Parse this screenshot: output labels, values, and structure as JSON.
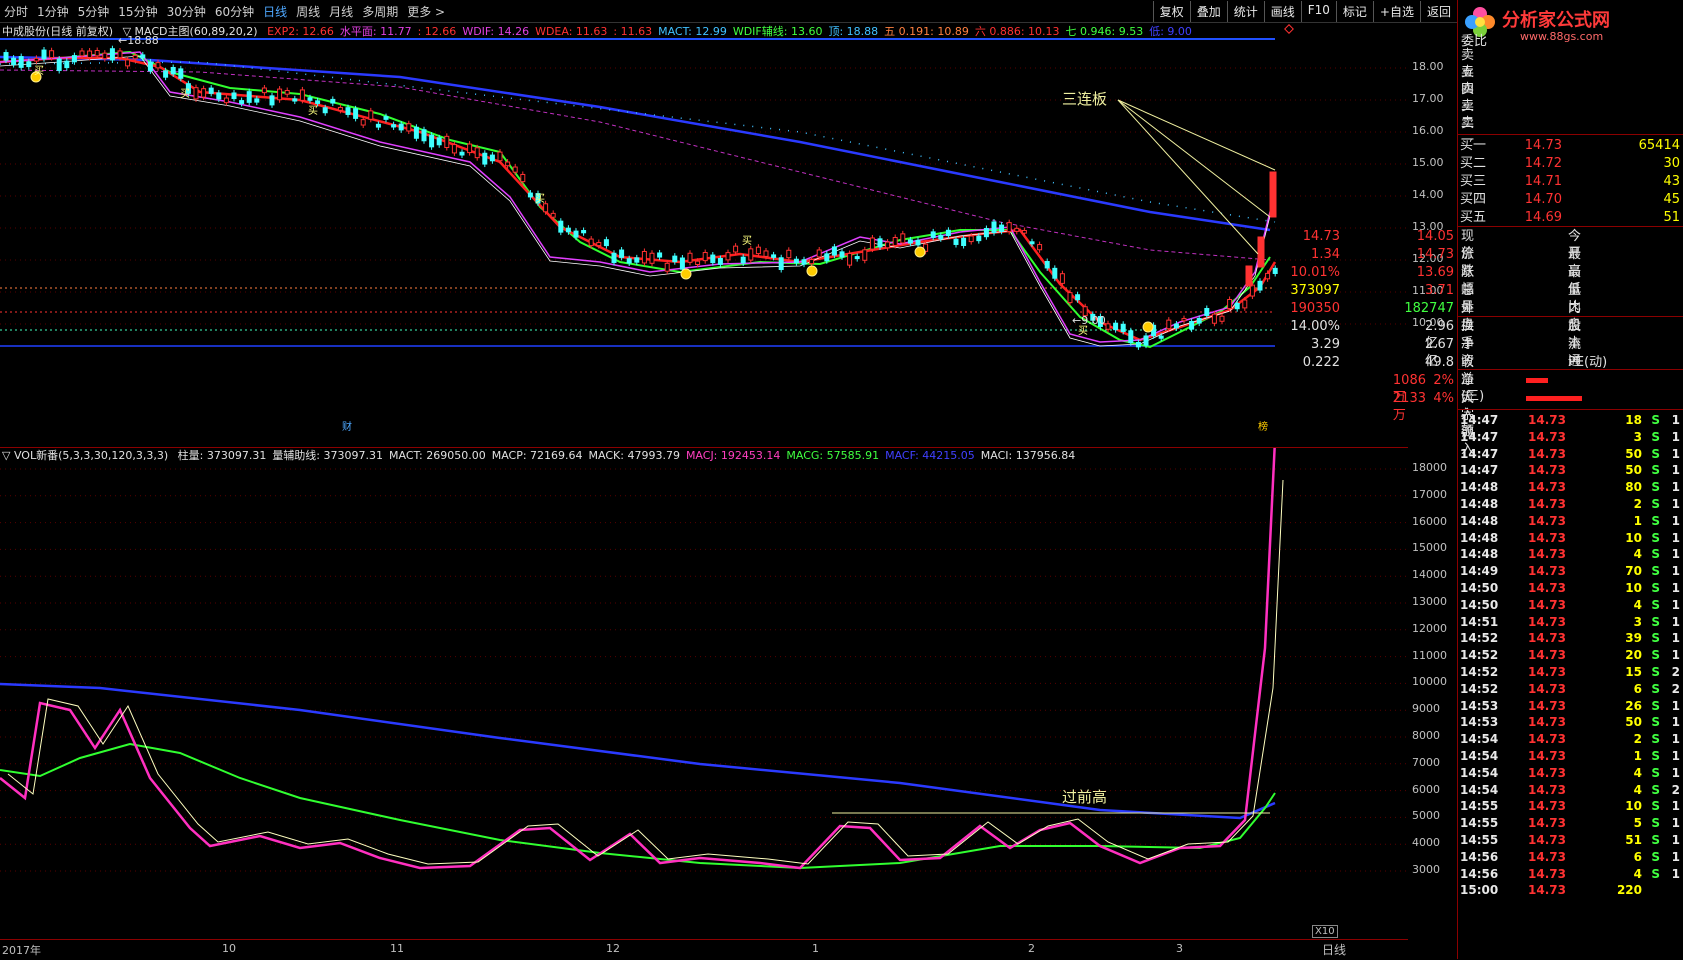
{
  "toolbar": {
    "periods": [
      "分时",
      "1分钟",
      "5分钟",
      "15分钟",
      "30分钟",
      "60分钟",
      "日线",
      "周线",
      "月线",
      "多周期",
      "更多 >"
    ],
    "active_period": "日线",
    "buttons": [
      "复权",
      "叠加",
      "统计",
      "画线",
      "F10",
      "标记",
      "+自选",
      "返回"
    ]
  },
  "main_info": {
    "stock": "中成股份(日线 前复权)",
    "indicator": "▽ MACD主图(60,89,20,2)",
    "items": [
      {
        "text": "EXP2: 12.66",
        "color": "#ff3232"
      },
      {
        "text": "水平面: 11.77",
        "color": "#e040e0"
      },
      {
        "text": ": 12.66",
        "color": "#ff3232"
      },
      {
        "text": "WDIF: 14.26",
        "color": "#e040e0"
      },
      {
        "text": "WDEA: 11.63",
        "color": "#ff3232"
      },
      {
        "text": ": 11.63",
        "color": "#ff3232"
      },
      {
        "text": "MACT: 12.99",
        "color": "#40c0ff"
      },
      {
        "text": "WDIF辅线: 13.60",
        "color": "#40ff40"
      },
      {
        "text": "顶: 18.88",
        "color": "#40c0ff"
      },
      {
        "text": "五 0.191: 10.89",
        "color": "#ff8040"
      },
      {
        "text": "六 0.886: 10.13",
        "color": "#ff3232"
      },
      {
        "text": "七 0.946: 9.53",
        "color": "#40ff40"
      },
      {
        "text": "低: 9.00",
        "color": "#4040ff"
      }
    ]
  },
  "main_marks": {
    "high_label": "18.88",
    "low_label": "9.00",
    "buy": "买",
    "cai": "财",
    "bang": "榜"
  },
  "annotations": {
    "three_limit": "三连板",
    "past_high": "过前高"
  },
  "price_axis": [
    "18.00",
    "17.00",
    "16.00",
    "15.00",
    "14.00",
    "13.00",
    "12.00",
    "11.00",
    "10.00"
  ],
  "vol_info": {
    "indicator": "▽ VOL新番(5,3,3,30,120,3,3,3)",
    "items": [
      {
        "text": "柱量: 373097.31",
        "color": "#e0e0e0"
      },
      {
        "text": "量辅助线: 373097.31",
        "color": "#e0e0e0"
      },
      {
        "text": "MACT: 269050.00",
        "color": "#e0e0e0"
      },
      {
        "text": "MACP: 72169.64",
        "color": "#e0e0e0"
      },
      {
        "text": "MACK: 47993.79",
        "color": "#e0e0e0"
      },
      {
        "text": "MACJ: 192453.14",
        "color": "#ff40c0"
      },
      {
        "text": "MACG: 57585.91",
        "color": "#40ff40"
      },
      {
        "text": "MACF: 44215.05",
        "color": "#4040ff"
      },
      {
        "text": "MACI: 137956.84",
        "color": "#e0e0e0"
      }
    ]
  },
  "vol_axis": [
    "18000",
    "17000",
    "16000",
    "15000",
    "14000",
    "13000",
    "12000",
    "11000",
    "10000",
    "9000",
    "8000",
    "7000",
    "6000",
    "5000",
    "4000",
    "3000"
  ],
  "vol_scale": "X10",
  "date_axis": [
    "2017年",
    "10",
    "11",
    "12",
    "1",
    "2",
    "3"
  ],
  "axis_mode": "日线",
  "side": {
    "logo_text": "分析家公式网",
    "logo_url": "www.88gs.com",
    "order_label": "委比",
    "sells": [
      "卖五",
      "卖四",
      "卖三",
      "卖二",
      "卖一"
    ],
    "buys": [
      {
        "label": "买一",
        "price": "14.73",
        "vol": "65414"
      },
      {
        "label": "买二",
        "price": "14.72",
        "vol": "30"
      },
      {
        "label": "买三",
        "price": "14.71",
        "vol": "43"
      },
      {
        "label": "买四",
        "price": "14.70",
        "vol": "45"
      },
      {
        "label": "买五",
        "price": "14.69",
        "vol": "51"
      }
    ],
    "quote": [
      {
        "l1": "现价",
        "v1": "14.73",
        "l2": "今开",
        "v2": "14.05"
      },
      {
        "l1": "涨跌",
        "v1": "1.34",
        "l2": "最高",
        "v2": "14.73"
      },
      {
        "l1": "涨幅",
        "v1": "10.01%",
        "l2": "最低",
        "v2": "13.69"
      },
      {
        "l1": "总量",
        "v1": "373097",
        "l2": "量比",
        "v2": "3.71"
      },
      {
        "l1": "外盘",
        "v1": "190350",
        "l2": "内盘",
        "v2": "182747"
      }
    ],
    "fund": [
      {
        "l1": "换手",
        "v1": "14.00%",
        "l2": "股本",
        "v2": "2.96亿"
      },
      {
        "l1": "净资",
        "v1": "3.29",
        "l2": "流通",
        "v2": "2.67亿"
      },
      {
        "l1": "收益(三)",
        "v1": "0.222",
        "l2": "PE(动)",
        "v2": "49.8"
      }
    ],
    "flow": [
      {
        "label": "净流入额",
        "value": "1086万",
        "pct": "2%"
      },
      {
        "label": "大宗流入",
        "value": "2133万",
        "pct": "4%"
      }
    ],
    "ticks": [
      {
        "t": "14:47",
        "p": "14.73",
        "v": "18",
        "d": "S",
        "n": "1"
      },
      {
        "t": "14:47",
        "p": "14.73",
        "v": "3",
        "d": "S",
        "n": "1"
      },
      {
        "t": "14:47",
        "p": "14.73",
        "v": "50",
        "d": "S",
        "n": "1"
      },
      {
        "t": "14:47",
        "p": "14.73",
        "v": "50",
        "d": "S",
        "n": "1"
      },
      {
        "t": "14:48",
        "p": "14.73",
        "v": "80",
        "d": "S",
        "n": "1"
      },
      {
        "t": "14:48",
        "p": "14.73",
        "v": "2",
        "d": "S",
        "n": "1"
      },
      {
        "t": "14:48",
        "p": "14.73",
        "v": "1",
        "d": "S",
        "n": "1"
      },
      {
        "t": "14:48",
        "p": "14.73",
        "v": "10",
        "d": "S",
        "n": "1"
      },
      {
        "t": "14:48",
        "p": "14.73",
        "v": "4",
        "d": "S",
        "n": "1"
      },
      {
        "t": "14:49",
        "p": "14.73",
        "v": "70",
        "d": "S",
        "n": "1"
      },
      {
        "t": "14:50",
        "p": "14.73",
        "v": "10",
        "d": "S",
        "n": "1"
      },
      {
        "t": "14:50",
        "p": "14.73",
        "v": "4",
        "d": "S",
        "n": "1"
      },
      {
        "t": "14:51",
        "p": "14.73",
        "v": "3",
        "d": "S",
        "n": "1"
      },
      {
        "t": "14:52",
        "p": "14.73",
        "v": "39",
        "d": "S",
        "n": "1"
      },
      {
        "t": "14:52",
        "p": "14.73",
        "v": "20",
        "d": "S",
        "n": "1"
      },
      {
        "t": "14:52",
        "p": "14.73",
        "v": "15",
        "d": "S",
        "n": "2"
      },
      {
        "t": "14:52",
        "p": "14.73",
        "v": "6",
        "d": "S",
        "n": "2"
      },
      {
        "t": "14:53",
        "p": "14.73",
        "v": "26",
        "d": "S",
        "n": "1"
      },
      {
        "t": "14:53",
        "p": "14.73",
        "v": "50",
        "d": "S",
        "n": "1"
      },
      {
        "t": "14:54",
        "p": "14.73",
        "v": "2",
        "d": "S",
        "n": "1"
      },
      {
        "t": "14:54",
        "p": "14.73",
        "v": "1",
        "d": "S",
        "n": "1"
      },
      {
        "t": "14:54",
        "p": "14.73",
        "v": "4",
        "d": "S",
        "n": "1"
      },
      {
        "t": "14:54",
        "p": "14.73",
        "v": "4",
        "d": "S",
        "n": "2"
      },
      {
        "t": "14:55",
        "p": "14.73",
        "v": "10",
        "d": "S",
        "n": "1"
      },
      {
        "t": "14:55",
        "p": "14.73",
        "v": "5",
        "d": "S",
        "n": "1"
      },
      {
        "t": "14:55",
        "p": "14.73",
        "v": "51",
        "d": "S",
        "n": "1"
      },
      {
        "t": "14:56",
        "p": "14.73",
        "v": "6",
        "d": "S",
        "n": "1"
      },
      {
        "t": "14:56",
        "p": "14.73",
        "v": "4",
        "d": "S",
        "n": "1"
      },
      {
        "t": "15:00",
        "p": "14.73",
        "v": "220",
        "d": "",
        "n": ""
      }
    ]
  }
}
